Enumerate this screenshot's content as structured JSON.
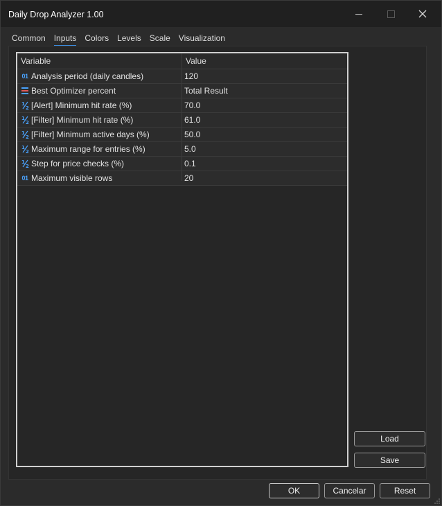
{
  "window": {
    "title": "Daily Drop Analyzer 1.00",
    "minimize_icon": "minimize-icon",
    "maximize_icon": "maximize-icon",
    "close_icon": "close-icon"
  },
  "tabs": [
    {
      "label": "Common"
    },
    {
      "label": "Inputs",
      "active": true
    },
    {
      "label": "Colors"
    },
    {
      "label": "Levels"
    },
    {
      "label": "Scale"
    },
    {
      "label": "Visualization"
    }
  ],
  "grid": {
    "headers": {
      "variable": "Variable",
      "value": "Value"
    },
    "rows": [
      {
        "icon": "int-icon",
        "icon_text": "01",
        "variable": "Analysis period (daily candles)",
        "value": "120"
      },
      {
        "icon": "enum-list-icon",
        "icon_text": "",
        "variable": "Best Optimizer percent",
        "value": "Total Result"
      },
      {
        "icon": "double-icon",
        "icon_text": "½",
        "variable": "[Alert] Minimum hit rate (%)",
        "value": "70.0"
      },
      {
        "icon": "double-icon",
        "icon_text": "½",
        "variable": "[Filter] Minimum hit rate (%)",
        "value": "61.0"
      },
      {
        "icon": "double-icon",
        "icon_text": "½",
        "variable": "[Filter] Minimum active days (%)",
        "value": "50.0"
      },
      {
        "icon": "double-icon",
        "icon_text": "½",
        "variable": "Maximum range for entries (%)",
        "value": "5.0"
      },
      {
        "icon": "double-icon",
        "icon_text": "½",
        "variable": "Step for price checks (%)",
        "value": "0.1"
      },
      {
        "icon": "int-icon",
        "icon_text": "01",
        "variable": "Maximum visible rows",
        "value": "20"
      }
    ]
  },
  "side_buttons": {
    "load": "Load",
    "save": "Save"
  },
  "footer": {
    "ok": "OK",
    "cancel": "Cancelar",
    "reset": "Reset"
  },
  "colors": {
    "accent": "#3d8ee0",
    "icon_blue": "#4aa3ff"
  }
}
